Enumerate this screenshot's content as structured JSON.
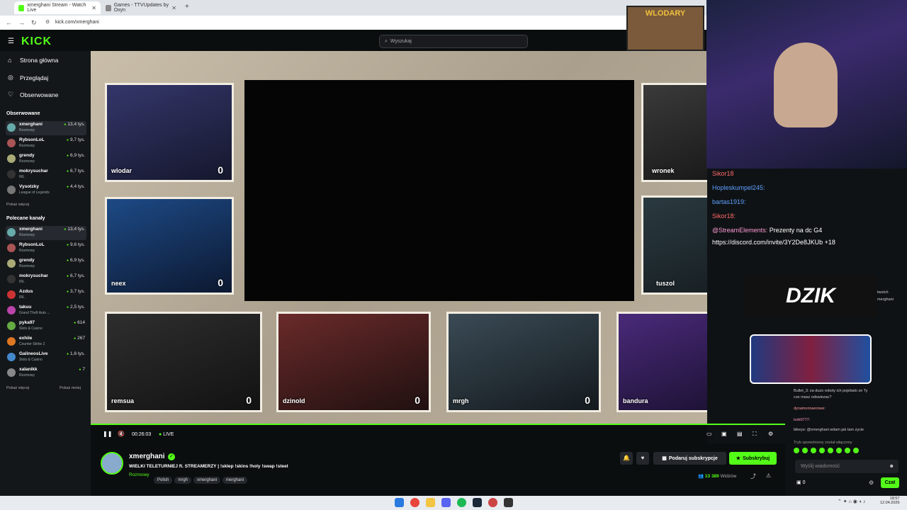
{
  "browser": {
    "tabs": [
      {
        "title": "xmerghani Stream - Watch Live"
      },
      {
        "title": "Games - TTVUpdates by Oxyn"
      }
    ],
    "url": "kick.com/xmerghani"
  },
  "nav": {
    "items": [
      {
        "label": "Strona główna",
        "icon": "home-icon"
      },
      {
        "label": "Przeglądaj",
        "icon": "compass-icon"
      },
      {
        "label": "Obserwowane",
        "icon": "heart-icon"
      }
    ]
  },
  "search": {
    "placeholder": "Wyszukaj"
  },
  "followed": {
    "title": "Obserwowane",
    "more": "Pokaż więcej",
    "channels": [
      {
        "name": "xmerghani",
        "cat": "Rozmowy",
        "views": "13,4 tys."
      },
      {
        "name": "RybsonLoL",
        "cat": "Rozmowy",
        "views": "9,7 tys."
      },
      {
        "name": "grendy",
        "cat": "Rozmowy",
        "views": "6,9 tys."
      },
      {
        "name": "mokrysuchar",
        "cat": "IRL",
        "views": "6,7 tys."
      },
      {
        "name": "Vysotzky",
        "cat": "League of Legends",
        "views": "4,4 tys."
      }
    ]
  },
  "recommended": {
    "title": "Polecane kanały",
    "more": "Pokaż więcej",
    "less": "Pokaż mniej",
    "channels": [
      {
        "name": "xmerghani",
        "cat": "Rozmowy",
        "views": "13,4 tys."
      },
      {
        "name": "RybsonLoL",
        "cat": "Rozmowy",
        "views": "9,6 tys."
      },
      {
        "name": "grendy",
        "cat": "Rozmowy",
        "views": "6,9 tys."
      },
      {
        "name": "mokrysuchar",
        "cat": "IRL",
        "views": "6,7 tys."
      },
      {
        "name": "Azdus",
        "cat": "IRL",
        "views": "3,7 tys."
      },
      {
        "name": "takuu",
        "cat": "Grand Theft Auto ...",
        "views": "2,5 tys."
      },
      {
        "name": "pyka97",
        "cat": "Slots & Casino",
        "views": "614"
      },
      {
        "name": "exhiie",
        "cat": "Counter-Strike 2",
        "views": "267"
      },
      {
        "name": "GalineosLive",
        "cat": "Slots & Casino",
        "views": "1,6 tys."
      },
      {
        "name": "xalanikk",
        "cat": "Rozmowy",
        "views": "7"
      }
    ]
  },
  "cams": [
    {
      "name": "wlodar",
      "score": "0"
    },
    {
      "name": "neex",
      "score": "0"
    },
    {
      "name": "wronek",
      "score": ""
    },
    {
      "name": "tuszol",
      "score": ""
    },
    {
      "name": "remsua",
      "score": "0"
    },
    {
      "name": "dzinold",
      "score": "0"
    },
    {
      "name": "mrgh",
      "score": "0"
    },
    {
      "name": "bandura",
      "score": "0"
    }
  ],
  "overlay": {
    "banner": "WLODARY",
    "sponsor": "DZIK"
  },
  "player": {
    "time": "00:26:03",
    "live": "LIVE"
  },
  "channel": {
    "name": "xmerghani",
    "title": "WIELKI TELETURNIEJ ft. STREAMERZY | !sklep !skins !holy !swap !steel",
    "category": "Rozmowy",
    "tags": [
      "Polish",
      "mrgh",
      "xmerghani",
      "merghani"
    ],
    "gift": "Podaruj subskrypcje",
    "subscribe": "Subskrybuj",
    "viewers": "13 389",
    "viewers_label": "Widzów"
  },
  "chat_overlay": [
    {
      "user": "Sikor18",
      "text": ""
    },
    {
      "user": "Hopleskumpel245:",
      "text": ""
    },
    {
      "user": "bartas1919:",
      "text": ""
    },
    {
      "user": "Sikor18:",
      "text": ""
    },
    {
      "user": "@StreamElements:",
      "text": "Prezenty na dc G4"
    },
    {
      "user": "",
      "text": "https://discord.com/invite/3Y2De8JKUb +18"
    }
  ],
  "chat": {
    "lines": [
      "Bullet_3: za duzo roboty ich pojebalo ze Ty",
      "cos masz odswiezac?",
      "dynamorowerowe:",
      "turb0777:",
      "bikeys: @xmerghani witam jak tam zycie",
      "Tryb spowolniony został włączony"
    ],
    "side": [
      "twoich",
      "merghani"
    ],
    "input_placeholder": "Wyślij wiadomość",
    "send": "Czat",
    "points": "0"
  },
  "clock": {
    "time": "18:57",
    "date": "12.04.2026"
  }
}
